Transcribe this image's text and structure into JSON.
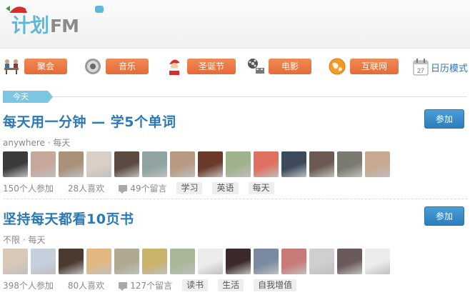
{
  "brand": {
    "logo_text": "计划",
    "logo_suffix": "FM"
  },
  "categories": [
    {
      "label": "聚会",
      "icon": "party-people-icon"
    },
    {
      "label": "音乐",
      "icon": "speaker-icon"
    },
    {
      "label": "圣诞节",
      "icon": "santa-icon"
    },
    {
      "label": "电影",
      "icon": "film-reel-icon"
    },
    {
      "label": "互联网",
      "icon": "globe-icon"
    }
  ],
  "calendar_mode": {
    "label": "日历模式",
    "day": "27",
    "icon": "calendar-icon"
  },
  "today_label": "今天",
  "plans": [
    {
      "title": "每天用一分钟 — 学5个单词",
      "location": "anywhere",
      "frequency": "每天",
      "join_label": "参加",
      "participants": "150个人参加",
      "likes": "28人喜欢",
      "comments": "49个留言",
      "tags": [
        "学习",
        "英语",
        "每天"
      ],
      "avatar_colors": [
        "#3b3b3b",
        "#c7a79a",
        "#a89079",
        "#d9cfc6",
        "#5a4a40",
        "#8fa3a0",
        "#b89a84",
        "#6b3a2a",
        "#9fb38a",
        "#e07060",
        "#3c4a5c",
        "#6a5a52",
        "#7a7a70",
        "#c8a890"
      ]
    },
    {
      "title": "坚持每天都看10页书",
      "location": "不限",
      "frequency": "每天",
      "join_label": "参加",
      "participants": "398个人参加",
      "likes": "80人喜欢",
      "comments": "127个留言",
      "tags": [
        "读书",
        "生活",
        "自我增值"
      ],
      "avatar_colors": [
        "#d8c8b8",
        "#c5d0dc",
        "#4a3a30",
        "#e2b880",
        "#b0a890",
        "#c9b26a",
        "#a8b898",
        "#ececec",
        "#3a2a2a",
        "#7a8aa0",
        "#c87a78",
        "#cfcfcf",
        "#6a5a5a",
        "#ececec"
      ]
    }
  ],
  "colors": {
    "accent_blue": "#2a79b5",
    "category_orange": "#e8753f",
    "join_blue": "#3a8dcc",
    "today_tab": "#7cc6df"
  }
}
